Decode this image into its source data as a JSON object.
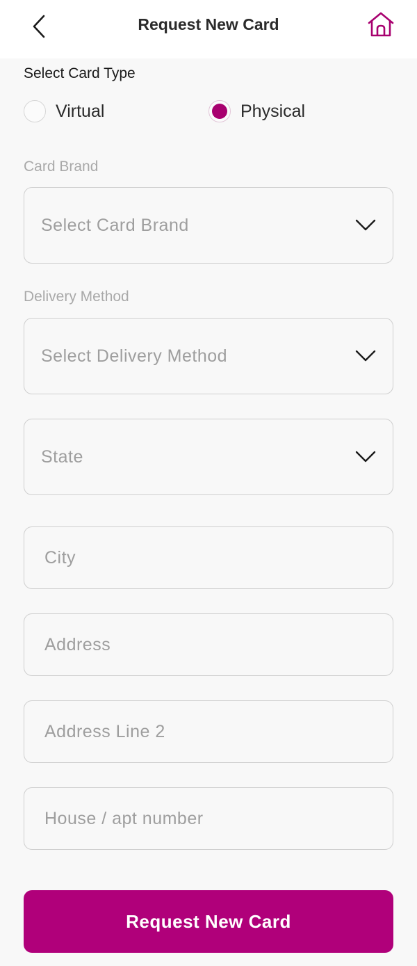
{
  "header": {
    "title": "Request New Card"
  },
  "card_type": {
    "label": "Select Card Type",
    "options": [
      {
        "label": "Virtual",
        "selected": false
      },
      {
        "label": "Physical",
        "selected": true
      }
    ]
  },
  "card_brand": {
    "label": "Card Brand",
    "placeholder": "Select Card Brand"
  },
  "delivery_method": {
    "label": "Delivery Method",
    "placeholder": "Select Delivery Method"
  },
  "state": {
    "placeholder": "State"
  },
  "city": {
    "placeholder": "City"
  },
  "address": {
    "placeholder": "Address"
  },
  "address_line_2": {
    "placeholder": "Address Line 2"
  },
  "house_number": {
    "placeholder": "House / apt number"
  },
  "submit": {
    "label": "Request New Card"
  },
  "colors": {
    "accent": "#b0007a",
    "background": "#f8f8f8"
  }
}
